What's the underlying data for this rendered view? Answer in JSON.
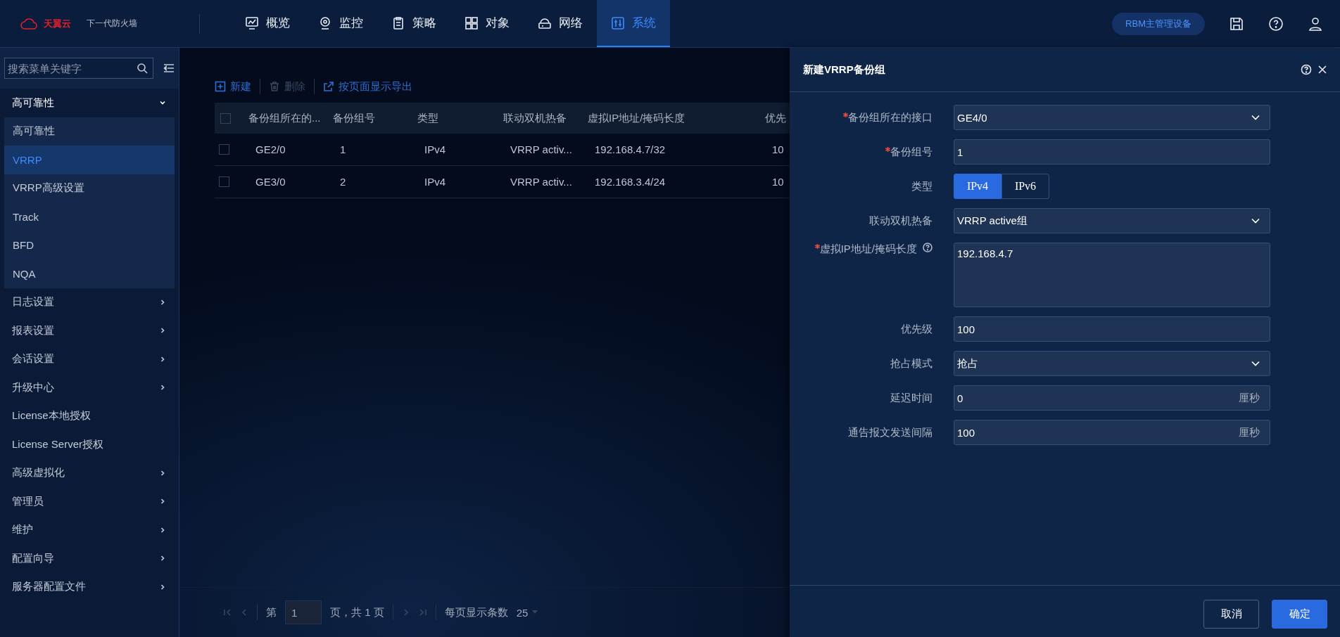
{
  "header": {
    "logo": "天翼云",
    "product": "下一代防火墙",
    "nav": [
      {
        "label": "概览",
        "selected": false
      },
      {
        "label": "监控",
        "selected": false
      },
      {
        "label": "策略",
        "selected": false
      },
      {
        "label": "对象",
        "selected": false
      },
      {
        "label": "网络",
        "selected": false
      },
      {
        "label": "系统",
        "selected": true
      }
    ],
    "device_badge": "RBM主管理设备"
  },
  "sidebar": {
    "search": {
      "placeholder": "搜索菜单关键字"
    },
    "items": [
      {
        "label": "高可靠性",
        "kind": "group",
        "expanded": true,
        "children": [
          {
            "label": "高可靠性",
            "selected": false
          },
          {
            "label": "VRRP",
            "selected": true
          },
          {
            "label": "VRRP高级设置",
            "selected": false
          },
          {
            "label": "Track",
            "selected": false
          },
          {
            "label": "BFD",
            "selected": false
          },
          {
            "label": "NQA",
            "selected": false
          }
        ]
      },
      {
        "label": "日志设置",
        "kind": "group",
        "expanded": false
      },
      {
        "label": "报表设置",
        "kind": "group",
        "expanded": false
      },
      {
        "label": "会话设置",
        "kind": "group",
        "expanded": false
      },
      {
        "label": "升级中心",
        "kind": "group",
        "expanded": false
      },
      {
        "label": "License本地授权",
        "kind": "link"
      },
      {
        "label": "License Server授权",
        "kind": "link"
      },
      {
        "label": "高级虚拟化",
        "kind": "group",
        "expanded": false
      },
      {
        "label": "管理员",
        "kind": "group",
        "expanded": false
      },
      {
        "label": "维护",
        "kind": "group",
        "expanded": false
      },
      {
        "label": "配置向导",
        "kind": "group",
        "expanded": false
      },
      {
        "label": "服务器配置文件",
        "kind": "group",
        "expanded": false
      }
    ]
  },
  "toolbar": [
    {
      "label": "新建",
      "disabled": false
    },
    {
      "label": "删除",
      "disabled": true
    },
    {
      "label": "按页面显示导出",
      "disabled": false
    }
  ],
  "table": {
    "all_checked": false,
    "columns": [
      "备份组所在的...",
      "备份组号",
      "类型",
      "联动双机热备",
      "虚拟IP地址/掩码长度",
      "优先"
    ],
    "rows": [
      {
        "checked": false,
        "cells": [
          "GE2/0",
          "1",
          "IPv4",
          "VRRP activ...",
          "192.168.4.7/32",
          "10"
        ]
      },
      {
        "checked": false,
        "cells": [
          "GE3/0",
          "2",
          "IPv4",
          "VRRP activ...",
          "192.168.3.4/24",
          "10"
        ]
      }
    ]
  },
  "pagination": {
    "page_prefix": "第",
    "page": "1",
    "page_suffix": "页，共 1 页",
    "page_size_label": "每页显示条数",
    "page_size": "25"
  },
  "dialog": {
    "title": "新建VRRP备份组",
    "fields": [
      {
        "label": "备份组所在的接口",
        "required": true,
        "kind": "select",
        "value": "GE4/0"
      },
      {
        "label": "备份组号",
        "required": true,
        "kind": "input",
        "value": "1"
      },
      {
        "label": "类型",
        "required": false,
        "kind": "segmented",
        "options": [
          {
            "label": "IPv4",
            "selected": true
          },
          {
            "label": "IPv6",
            "selected": false
          }
        ]
      },
      {
        "label": "联动双机热备",
        "required": false,
        "kind": "select",
        "value": "VRRP active组"
      },
      {
        "label": "虚拟IP地址/掩码长度",
        "required": true,
        "help": true,
        "kind": "textarea",
        "value": "192.168.4.7"
      },
      {
        "label": "优先级",
        "required": false,
        "kind": "input",
        "value": "100"
      },
      {
        "label": "抢占模式",
        "required": false,
        "kind": "select",
        "value": "抢占"
      },
      {
        "label": "延迟时间",
        "required": false,
        "kind": "input",
        "value": "0",
        "unit": "厘秒"
      },
      {
        "label": "通告报文发送间隔",
        "required": false,
        "kind": "input",
        "value": "100",
        "unit": "厘秒"
      }
    ],
    "buttons": [
      {
        "label": "取消",
        "kind": "secondary"
      },
      {
        "label": "确定",
        "kind": "primary"
      }
    ]
  }
}
